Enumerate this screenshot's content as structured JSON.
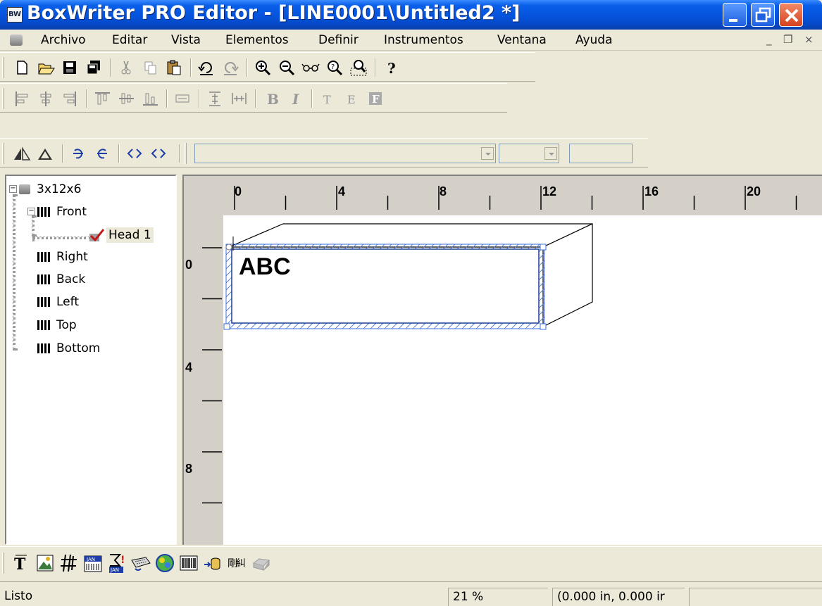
{
  "window": {
    "title": "BoxWriter PRO Editor - [LINE0001\\Untitled2 *]",
    "app_icon_text": "BW",
    "controls": [
      "minimize-icon",
      "restore-icon",
      "close-icon"
    ]
  },
  "menu": {
    "items": [
      "Archivo",
      "Editar",
      "Vista",
      "Elementos",
      "Definir",
      "Instrumentos",
      "Ventana",
      "Ayuda"
    ],
    "mdi_controls": [
      "_",
      "❐",
      "×"
    ]
  },
  "toolbar1": {
    "icons": [
      "new-icon",
      "open-icon",
      "save-icon",
      "save-all-icon",
      "cut-icon",
      "copy-icon",
      "paste-icon",
      "undo-icon",
      "redo-icon",
      "zoom-in-icon",
      "zoom-out-icon",
      "view-icon",
      "zoom-fit-icon",
      "zoom-select-icon",
      "help-icon"
    ]
  },
  "toolbar2": {
    "icons": [
      "align-left-icon",
      "align-center-icon",
      "align-right-icon",
      "align-top-icon",
      "align-middle-icon",
      "align-bottom-icon",
      "same-width-icon",
      "space-vertical-icon",
      "space-horizontal-icon",
      "bold-icon",
      "italic-icon",
      "font-t-icon",
      "font-e-icon",
      "font-f-icon"
    ]
  },
  "toolbar3": {
    "icons": [
      "flip-horizontal-icon",
      "flip-vertical-icon",
      "rotate-left-icon",
      "rotate-right-icon",
      "mirror-left-icon",
      "mirror-right-icon"
    ],
    "font_combo_value": "",
    "size_combo_value": "",
    "extra_field_value": ""
  },
  "tree": {
    "root": "3x12x6",
    "faces": [
      "Front",
      "Right",
      "Back",
      "Left",
      "Top",
      "Bottom"
    ],
    "head": "Head 1",
    "selected": "Head 1"
  },
  "rulers": {
    "h_labels": [
      "0",
      "4",
      "8",
      "12",
      "16",
      "20"
    ],
    "v_labels": [
      "0",
      "4",
      "8"
    ],
    "unit": "in"
  },
  "canvas": {
    "element_text": "ABC",
    "selection_color": "#3a6fd8"
  },
  "palette": {
    "icons": [
      "text-tool-icon",
      "image-tool-icon",
      "barcode-hash-icon",
      "jan-barcode-icon",
      "jan-alert-icon",
      "keyboard-icon",
      "logo-tool-icon",
      "barcode-icon",
      "datasource-icon",
      "counter-icon",
      "printer-icon"
    ]
  },
  "status": {
    "message": "Listo",
    "zoom": "21 %",
    "coordinates": "(0.000 in, 0.000 ir",
    "extra": ""
  }
}
